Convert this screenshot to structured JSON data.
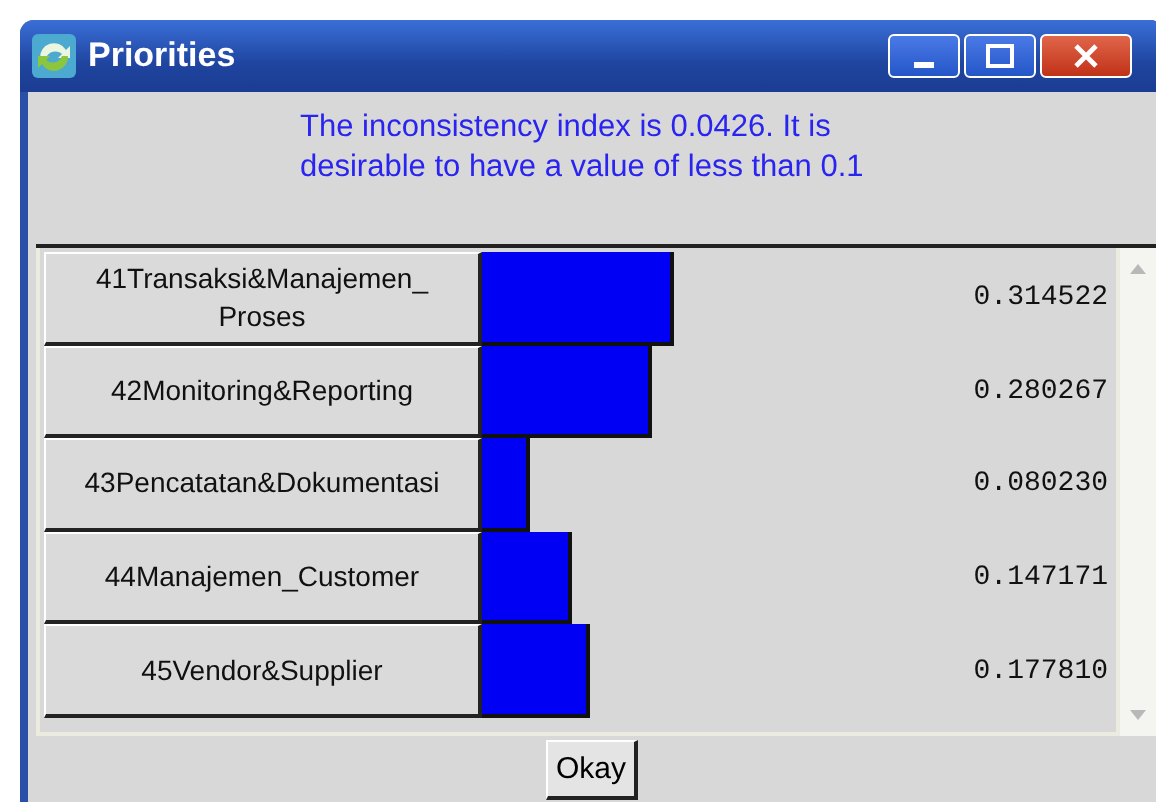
{
  "window": {
    "title": "Priorities"
  },
  "message": "The inconsistency index is 0.0426.  It is desirable to have a value of less than 0.1",
  "priorities": [
    {
      "name": "41Transaksi&Manajemen_ Proses",
      "reading": "0.314522"
    },
    {
      "name": "42Monitoring&Reporting",
      "reading": "0.280267"
    },
    {
      "name": "43Pencatatan&Dokumentasi",
      "reading": "0.080230"
    },
    {
      "name": "44Manajemen_Customer",
      "reading": "0.147171"
    },
    {
      "name": "45Vendor&Supplier",
      "reading": "0.177810"
    }
  ],
  "buttons": [
    "Okay"
  ]
}
